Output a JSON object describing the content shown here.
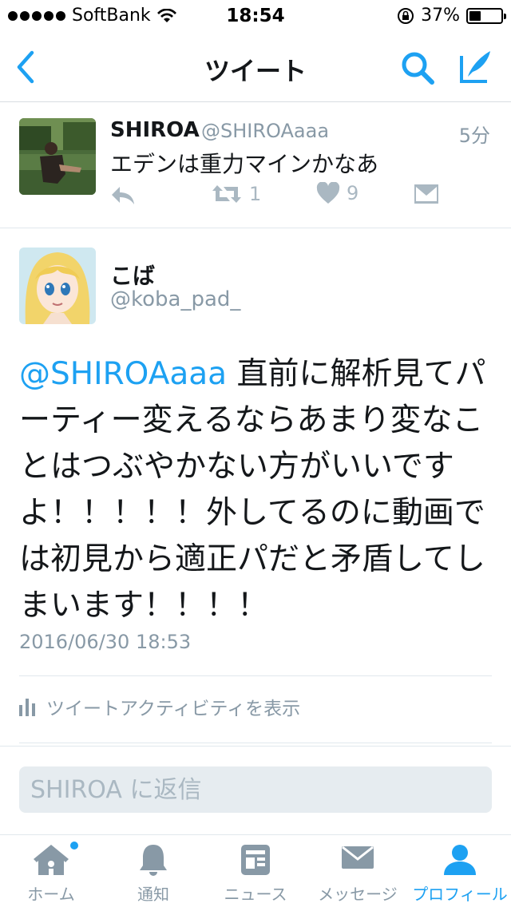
{
  "status_bar": {
    "carrier": "SoftBank",
    "time": "18:54",
    "battery_percent": "37%",
    "battery_level": 0.37,
    "icons": [
      "signal-dots-icon",
      "wifi-icon",
      "rotation-lock-icon",
      "battery-icon"
    ]
  },
  "nav": {
    "title": "ツイート",
    "back_icon": "chevron-left-icon",
    "search_icon": "search-icon",
    "compose_icon": "compose-tweet-icon"
  },
  "previous_tweet": {
    "name": "SHIROA",
    "handle": "@SHIROAaaa",
    "time": "5分",
    "text": "エデンは重力マインかなあ",
    "retweet_count": "1",
    "like_count": "9"
  },
  "tweet": {
    "name": "こば",
    "handle": "@koba_pad_",
    "mention": "@SHIROAaaa",
    "body": " 直前に解析見てパーティー変えるならあまり変なことはつぶやかない方がいいですよ！！！！！外してるのに動画では初見から適正パだと矛盾してしまいます！！！！",
    "date": "2016/06/30 18:53",
    "activity_label": "ツイートアクティビティを表示"
  },
  "reply": {
    "placeholder": "SHIROA に返信"
  },
  "tabs": [
    {
      "label": "ホーム",
      "icon": "home-icon",
      "active": false
    },
    {
      "label": "通知",
      "icon": "bell-icon",
      "active": false
    },
    {
      "label": "ニュース",
      "icon": "news-icon",
      "active": false
    },
    {
      "label": "メッセージ",
      "icon": "envelope-icon",
      "active": false
    },
    {
      "label": "プロフィール",
      "icon": "person-icon",
      "active": true
    }
  ],
  "colors": {
    "accent": "#1da1f2",
    "muted": "#8899a6",
    "text": "#14171a",
    "icon_gray": "#aab8c2"
  }
}
